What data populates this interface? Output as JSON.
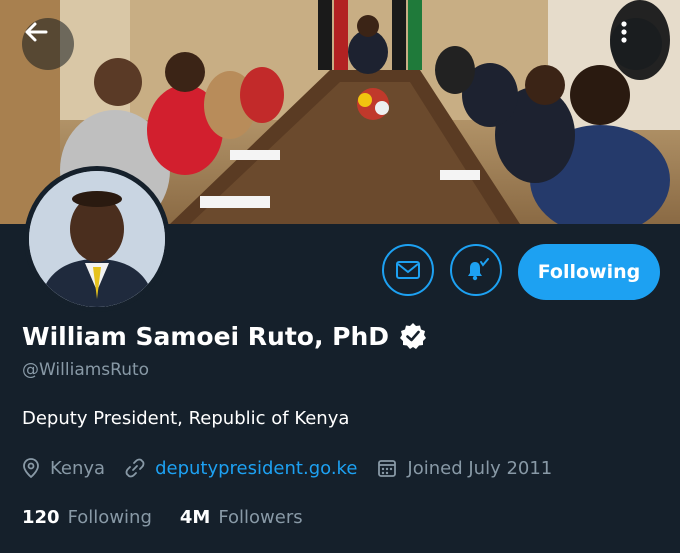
{
  "header": {
    "back_icon": "arrow-left-icon",
    "more_icon": "more-vertical-icon"
  },
  "actions": {
    "message_icon": "mail-icon",
    "notify_icon": "bell-plus-icon",
    "follow_label": "Following"
  },
  "profile": {
    "name": "William Samoei Ruto, PhD",
    "verified": true,
    "handle": "@WilliamsRuto",
    "bio": "Deputy President, Republic of Kenya",
    "location": "Kenya",
    "website": "deputypresident.go.ke",
    "joined": "Joined July 2011"
  },
  "stats": {
    "following_count": "120",
    "following_label": "Following",
    "followers_count": "4M",
    "followers_label": "Followers"
  },
  "colors": {
    "background": "#15202b",
    "accent": "#1da1f2",
    "secondary_text": "#8899a6"
  }
}
